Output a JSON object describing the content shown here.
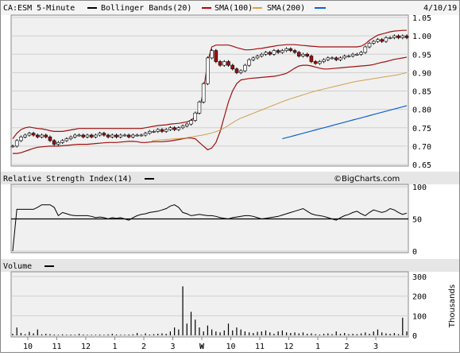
{
  "header": {
    "symbol": "CA:ESM 5-Minute",
    "date": "4/10/19",
    "legend": [
      {
        "label": "Bollinger Bands(20)",
        "color": "#000000"
      },
      {
        "label": "SMA(100)",
        "color": "#c00000"
      },
      {
        "label": "SMA(200)",
        "color": "#e0a040"
      },
      {
        "label": "",
        "color": "#1060d0"
      }
    ]
  },
  "rsi_panel": {
    "title": "Relative Strength Index(14)",
    "watermark": "©BigCharts.com"
  },
  "volume_panel": {
    "title": "Volume",
    "unit_label": "Thousands"
  },
  "chart_data": [
    {
      "type": "candlestick",
      "title": "CA:ESM 5-Minute",
      "ylim": [
        0.65,
        1.05
      ],
      "yticks": [
        "0.65",
        "0.70",
        "0.75",
        "0.80",
        "0.85",
        "0.90",
        "0.95",
        "1.00",
        "1.05"
      ],
      "grid": true,
      "close": [
        0.7,
        0.715,
        0.725,
        0.73,
        0.735,
        0.73,
        0.725,
        0.73,
        0.725,
        0.715,
        0.705,
        0.71,
        0.715,
        0.72,
        0.725,
        0.73,
        0.73,
        0.725,
        0.73,
        0.725,
        0.73,
        0.735,
        0.73,
        0.725,
        0.73,
        0.725,
        0.73,
        0.73,
        0.725,
        0.73,
        0.73,
        0.73,
        0.735,
        0.74,
        0.74,
        0.745,
        0.74,
        0.745,
        0.75,
        0.745,
        0.75,
        0.755,
        0.76,
        0.77,
        0.79,
        0.82,
        0.87,
        0.94,
        0.96,
        0.93,
        0.92,
        0.93,
        0.92,
        0.91,
        0.9,
        0.905,
        0.92,
        0.935,
        0.94,
        0.945,
        0.95,
        0.955,
        0.95,
        0.96,
        0.955,
        0.96,
        0.965,
        0.96,
        0.955,
        0.945,
        0.95,
        0.945,
        0.93,
        0.925,
        0.93,
        0.935,
        0.94,
        0.94,
        0.935,
        0.94,
        0.945,
        0.945,
        0.95,
        0.95,
        0.955,
        0.97,
        0.98,
        0.985,
        0.99,
        0.985,
        0.995,
        0.995,
        1.0,
        0.995,
        1.0,
        0.995
      ],
      "bollinger_upper": [
        0.72,
        0.735,
        0.745,
        0.75,
        0.752,
        0.75,
        0.748,
        0.747,
        0.745,
        0.742,
        0.74,
        0.74,
        0.74,
        0.742,
        0.744,
        0.746,
        0.748,
        0.748,
        0.748,
        0.748,
        0.748,
        0.748,
        0.748,
        0.748,
        0.748,
        0.748,
        0.748,
        0.748,
        0.748,
        0.748,
        0.748,
        0.748,
        0.75,
        0.752,
        0.754,
        0.756,
        0.757,
        0.758,
        0.76,
        0.761,
        0.762,
        0.764,
        0.766,
        0.77,
        0.78,
        0.8,
        0.85,
        0.93,
        0.97,
        0.975,
        0.975,
        0.975,
        0.975,
        0.972,
        0.968,
        0.965,
        0.962,
        0.962,
        0.963,
        0.965,
        0.966,
        0.968,
        0.97,
        0.972,
        0.974,
        0.975,
        0.976,
        0.976,
        0.976,
        0.975,
        0.974,
        0.973,
        0.972,
        0.971,
        0.97,
        0.97,
        0.97,
        0.97,
        0.97,
        0.97,
        0.97,
        0.97,
        0.97,
        0.97,
        0.972,
        0.978,
        0.988,
        0.995,
        1.002,
        1.005,
        1.008,
        1.011,
        1.013,
        1.014,
        1.015,
        1.015
      ],
      "bollinger_lower": [
        0.68,
        0.68,
        0.682,
        0.686,
        0.69,
        0.694,
        0.697,
        0.698,
        0.699,
        0.7,
        0.7,
        0.7,
        0.701,
        0.702,
        0.703,
        0.704,
        0.705,
        0.705,
        0.705,
        0.706,
        0.707,
        0.708,
        0.709,
        0.71,
        0.71,
        0.71,
        0.711,
        0.712,
        0.713,
        0.713,
        0.712,
        0.71,
        0.71,
        0.711,
        0.712,
        0.712,
        0.712,
        0.713,
        0.714,
        0.716,
        0.718,
        0.72,
        0.722,
        0.722,
        0.72,
        0.71,
        0.7,
        0.69,
        0.695,
        0.71,
        0.74,
        0.78,
        0.82,
        0.85,
        0.87,
        0.88,
        0.882,
        0.884,
        0.885,
        0.886,
        0.887,
        0.888,
        0.889,
        0.89,
        0.892,
        0.895,
        0.898,
        0.905,
        0.912,
        0.918,
        0.92,
        0.92,
        0.918,
        0.915,
        0.912,
        0.91,
        0.91,
        0.911,
        0.912,
        0.913,
        0.914,
        0.915,
        0.916,
        0.917,
        0.918,
        0.919,
        0.92,
        0.922,
        0.925,
        0.928,
        0.93,
        0.933,
        0.936,
        0.938,
        0.94,
        0.942
      ],
      "sma100": [
        null,
        null,
        null,
        null,
        null,
        null,
        null,
        null,
        null,
        null,
        null,
        null,
        null,
        null,
        null,
        null,
        null,
        null,
        null,
        null,
        null,
        null,
        null,
        null,
        null,
        null,
        null,
        null,
        null,
        null,
        0.715,
        0.716,
        0.717,
        0.718,
        0.719,
        0.72,
        0.721,
        0.722,
        0.724,
        0.726,
        0.728,
        0.73,
        0.733,
        0.736,
        0.74,
        0.745,
        0.752,
        0.76,
        0.768,
        0.775,
        0.78,
        0.785,
        0.79,
        0.795,
        0.8,
        0.805,
        0.81,
        0.815,
        0.82,
        0.825,
        0.829,
        0.833,
        0.837,
        0.841,
        0.845,
        0.849,
        0.852,
        0.855,
        0.858,
        0.861,
        0.864,
        0.867,
        0.87,
        0.873,
        0.876,
        0.878,
        0.88,
        0.882,
        0.884,
        0.886,
        0.888,
        0.89,
        0.892,
        0.894,
        0.897,
        0.9
      ],
      "sma200": [
        null,
        null,
        null,
        null,
        null,
        null,
        null,
        null,
        null,
        null,
        null,
        null,
        null,
        null,
        null,
        null,
        null,
        null,
        null,
        null,
        null,
        null,
        null,
        null,
        null,
        null,
        null,
        null,
        null,
        null,
        null,
        null,
        null,
        null,
        null,
        null,
        null,
        null,
        null,
        null,
        null,
        null,
        null,
        null,
        null,
        null,
        null,
        null,
        null,
        null,
        null,
        null,
        null,
        null,
        null,
        null,
        null,
        null,
        null,
        null,
        null,
        null,
        null,
        null,
        null,
        0.72,
        0.723,
        0.726,
        0.729,
        0.732,
        0.735,
        0.738,
        0.741,
        0.744,
        0.747,
        0.75,
        0.753,
        0.756,
        0.759,
        0.762,
        0.765,
        0.768,
        0.771,
        0.774,
        0.777,
        0.78,
        0.783,
        0.786,
        0.789,
        0.792,
        0.795,
        0.798,
        0.801,
        0.804,
        0.807,
        0.81
      ]
    },
    {
      "type": "line",
      "title": "Relative Strength Index(14)",
      "ylim": [
        0,
        100
      ],
      "yticks": [
        "0",
        "50",
        "100"
      ],
      "reference_line": 50,
      "values": [
        0,
        65,
        65,
        65,
        65,
        65,
        68,
        72,
        72,
        72,
        68,
        55,
        60,
        58,
        56,
        55,
        55,
        55,
        55,
        54,
        52,
        53,
        52,
        50,
        52,
        51,
        52,
        50,
        48,
        52,
        55,
        57,
        58,
        60,
        61,
        62,
        64,
        66,
        70,
        72,
        68,
        60,
        58,
        55,
        56,
        57,
        56,
        55,
        55,
        54,
        52,
        51,
        50,
        52,
        53,
        54,
        55,
        55,
        54,
        52,
        50,
        51,
        52,
        53,
        54,
        56,
        58,
        60,
        62,
        64,
        66,
        62,
        58,
        56,
        55,
        54,
        52,
        50,
        48,
        52,
        55,
        57,
        60,
        62,
        58,
        55,
        60,
        64,
        62,
        60,
        62,
        66,
        64,
        60,
        57,
        59
      ]
    },
    {
      "type": "bar",
      "title": "Volume",
      "ylabel": "Thousands",
      "ylim": [
        0,
        300
      ],
      "yticks": [
        "0",
        "100",
        "200",
        "300"
      ],
      "values": [
        8,
        40,
        12,
        6,
        18,
        10,
        30,
        5,
        8,
        6,
        4,
        3,
        5,
        3,
        4,
        3,
        8,
        4,
        3,
        3,
        3,
        4,
        3,
        5,
        8,
        4,
        3,
        3,
        4,
        5,
        12,
        3,
        10,
        4,
        6,
        8,
        10,
        8,
        20,
        40,
        30,
        250,
        60,
        120,
        80,
        40,
        20,
        50,
        30,
        20,
        15,
        25,
        60,
        25,
        40,
        30,
        20,
        15,
        12,
        18,
        20,
        25,
        15,
        8,
        20,
        25,
        15,
        12,
        15,
        10,
        15,
        8,
        10,
        6,
        4,
        8,
        10,
        6,
        20,
        8,
        12,
        6,
        8,
        6,
        10,
        15,
        8,
        20,
        30,
        15,
        10,
        8,
        12,
        6,
        90,
        20
      ],
      "x_ticks": [
        "10",
        "11",
        "12",
        "1",
        "2",
        "3",
        "W",
        "10",
        "11",
        "12",
        "1",
        "2",
        "3"
      ]
    }
  ]
}
